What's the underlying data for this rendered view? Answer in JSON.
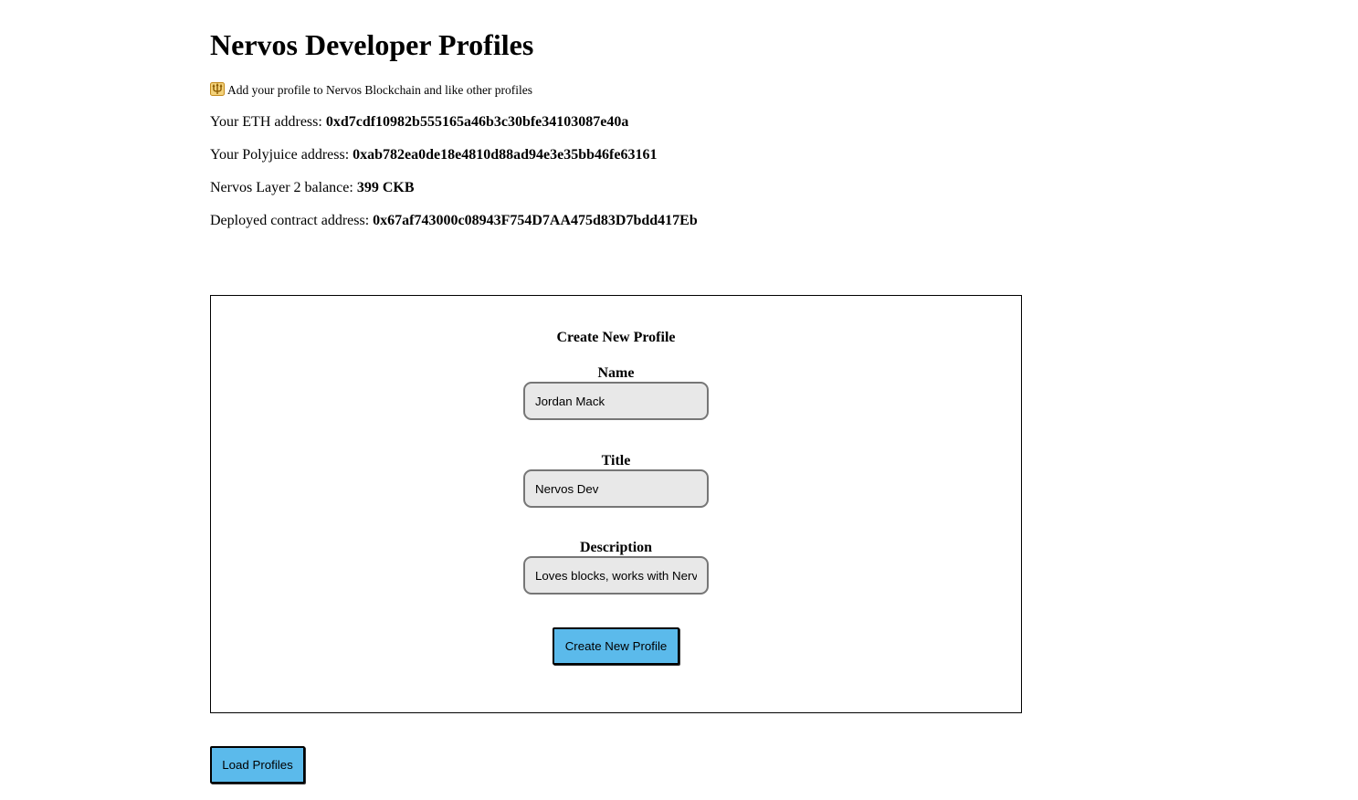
{
  "header": {
    "title": "Nervos Developer Profiles",
    "intro_icon": "trident-icon",
    "intro_text": "Add your profile to Nervos Blockchain and like other profiles"
  },
  "account": {
    "eth_label": "Your ETH address:",
    "eth_value": "0xd7cdf10982b555165a46b3c30bfe34103087e40a",
    "poly_label": "Your Polyjuice address:",
    "poly_value": "0xab782ea0de18e4810d88ad94e3e35bb46fe63161",
    "balance_label": "Nervos Layer 2 balance:",
    "balance_value": "399 CKB",
    "contract_label": "Deployed contract address:",
    "contract_value": "0x67af743000c08943F754D7AA475d83D7bdd417Eb"
  },
  "form": {
    "heading": "Create New Profile",
    "name_label": "Name",
    "name_value": "Jordan Mack",
    "title_label": "Title",
    "title_value": "Nervos Dev",
    "description_label": "Description",
    "description_value": "Loves blocks, works with Nervos",
    "submit_label": "Create New Profile"
  },
  "actions": {
    "load_label": "Load Profiles"
  },
  "colors": {
    "button_bg": "#5bbaeb",
    "input_bg": "#e8e8e8",
    "icon_gold": "#e0a020"
  }
}
